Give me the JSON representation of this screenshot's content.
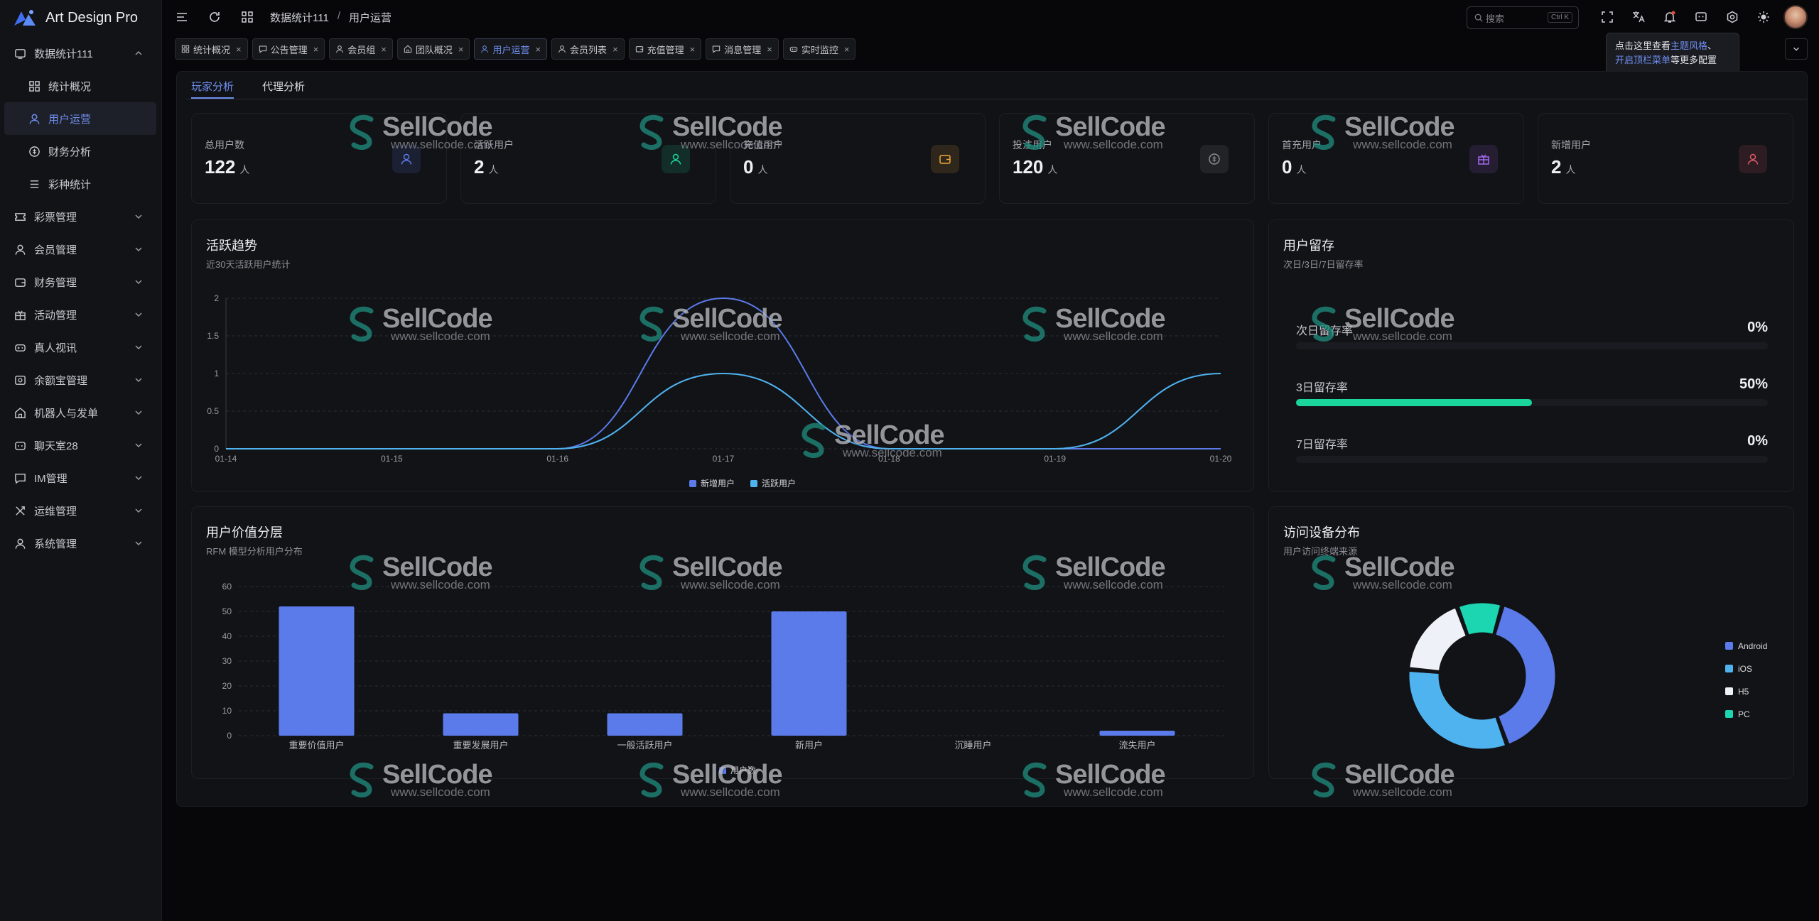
{
  "app": {
    "title": "Art Design Pro"
  },
  "sidebar": {
    "items": [
      {
        "label": "数据统计111",
        "icon": "dashboard-icon",
        "expanded": true
      },
      {
        "label": "统计概况",
        "icon": "grid-icon",
        "sub": true
      },
      {
        "label": "用户运营",
        "icon": "user-icon",
        "sub": true,
        "active": true
      },
      {
        "label": "财务分析",
        "icon": "coin-icon",
        "sub": true
      },
      {
        "label": "彩种统计",
        "icon": "list-icon",
        "sub": true
      },
      {
        "label": "彩票管理",
        "icon": "ticket-icon"
      },
      {
        "label": "会员管理",
        "icon": "user-icon"
      },
      {
        "label": "财务管理",
        "icon": "wallet-icon"
      },
      {
        "label": "活动管理",
        "icon": "gift-icon"
      },
      {
        "label": "真人视讯",
        "icon": "gamepad-icon"
      },
      {
        "label": "余额宝管理",
        "icon": "safe-icon"
      },
      {
        "label": "机器人与发单",
        "icon": "home-icon"
      },
      {
        "label": "聊天室28",
        "icon": "game-icon"
      },
      {
        "label": "IM管理",
        "icon": "message-icon"
      },
      {
        "label": "运维管理",
        "icon": "tools-icon"
      },
      {
        "label": "系统管理",
        "icon": "user-icon"
      }
    ]
  },
  "header": {
    "breadcrumb": [
      "数据统计111",
      "用户运营"
    ],
    "search_placeholder": "搜索",
    "search_kbd": "Ctrl K"
  },
  "tabs": [
    {
      "label": "统计概况"
    },
    {
      "label": "公告管理"
    },
    {
      "label": "会员组"
    },
    {
      "label": "团队概况"
    },
    {
      "label": "用户运营",
      "active": true
    },
    {
      "label": "会员列表"
    },
    {
      "label": "充值管理"
    },
    {
      "label": "消息管理"
    },
    {
      "label": "实时监控"
    }
  ],
  "tooltip": {
    "pre": "点击这里查看",
    "link1": "主题风格",
    "mid": "、",
    "link2": "开启顶栏菜单",
    "post": "等更多配置"
  },
  "subtabs": [
    "玩家分析",
    "代理分析"
  ],
  "stats": [
    {
      "label": "总用户数",
      "value": "122",
      "unit": "人",
      "color": "#5b7bea"
    },
    {
      "label": "活跃用户",
      "value": "2",
      "unit": "人",
      "color": "#1bd69c"
    },
    {
      "label": "充值用户",
      "value": "0",
      "unit": "人",
      "color": "#f0a93a"
    },
    {
      "label": "投注用户",
      "value": "120",
      "unit": "人",
      "color": "#8b8c94"
    },
    {
      "label": "首充用户",
      "value": "0",
      "unit": "人",
      "color": "#a46af0"
    },
    {
      "label": "新增用户",
      "value": "2",
      "unit": "人",
      "color": "#e05a6c"
    }
  ],
  "trend": {
    "title": "活跃趋势",
    "subtitle": "近30天活跃用户统计"
  },
  "retention": {
    "title": "用户留存",
    "subtitle": "次日/3日/7日留存率",
    "rows": [
      {
        "label": "次日留存率",
        "value": "0%",
        "ratio": 0
      },
      {
        "label": "3日留存率",
        "value": "50%",
        "ratio": 0.5
      },
      {
        "label": "7日留存率",
        "value": "0%",
        "ratio": 0
      }
    ]
  },
  "rfm": {
    "title": "用户价值分层",
    "subtitle": "RFM 模型分析用户分布"
  },
  "devices": {
    "title": "访问设备分布",
    "subtitle": "用户访问终端来源"
  },
  "chart_data": [
    {
      "type": "line",
      "x": [
        "01-14",
        "01-15",
        "01-16",
        "01-17",
        "01-18",
        "01-19",
        "01-20"
      ],
      "ylim": [
        0,
        2
      ],
      "yticks": [
        0,
        0.5,
        1,
        1.5,
        2
      ],
      "series": [
        {
          "name": "新增用户",
          "values": [
            0,
            0,
            0,
            2,
            0,
            0,
            0
          ],
          "color": "#5b7bea"
        },
        {
          "name": "活跃用户",
          "values": [
            0,
            0,
            0,
            1,
            0,
            0,
            1
          ],
          "color": "#4fb3f0"
        }
      ],
      "smooth": true,
      "grid": true,
      "legend": "bottom"
    },
    {
      "type": "bar",
      "categories": [
        "重要价值用户",
        "重要发展用户",
        "一般活跃用户",
        "新用户",
        "沉睡用户",
        "流失用户"
      ],
      "series": [
        {
          "name": "用户数",
          "values": [
            52,
            9,
            9,
            50,
            0,
            2
          ],
          "color": "#5b7bea"
        }
      ],
      "ylim": [
        0,
        60
      ],
      "yticks": [
        0,
        10,
        20,
        30,
        40,
        50,
        60
      ],
      "grid": true,
      "legend": "bottom"
    },
    {
      "type": "pie",
      "donut": true,
      "labels": [
        "Android",
        "iOS",
        "H5",
        "PC"
      ],
      "values": [
        40,
        32,
        18,
        10
      ],
      "colors": [
        "#5b7bea",
        "#4fb3f0",
        "#eef1f7",
        "#1bd6b0"
      ],
      "legend": "right"
    }
  ]
}
